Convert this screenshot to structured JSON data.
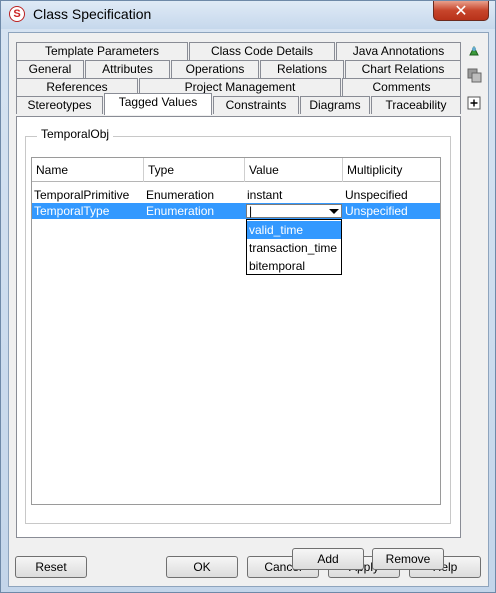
{
  "window": {
    "title": "Class Specification",
    "close_glyph": "✕",
    "app_icon": "S"
  },
  "tabs": {
    "row1": [
      "Template Parameters",
      "Class Code Details",
      "Java Annotations"
    ],
    "row2": [
      "General",
      "Attributes",
      "Operations",
      "Relations",
      "Chart Relations"
    ],
    "row3": [
      "References",
      "Project Management",
      "Comments"
    ],
    "row4": [
      "Stereotypes",
      "Tagged Values",
      "Constraints",
      "Diagrams",
      "Traceability"
    ],
    "active": "Tagged Values"
  },
  "panel": {
    "group_title": "TemporalObj",
    "columns": [
      "Name",
      "Type",
      "Value",
      "Multiplicity"
    ],
    "rows": [
      {
        "name": "TemporalPrimitive",
        "type": "Enumeration",
        "value": "instant",
        "multiplicity": "Unspecified"
      },
      {
        "name": "TemporalType",
        "type": "Enumeration",
        "value": "|",
        "multiplicity": "Unspecified"
      }
    ],
    "dropdown_options": [
      "valid_time",
      "transaction_time",
      "bitemporal"
    ],
    "dropdown_highlighted": "valid_time",
    "add_label": "Add",
    "remove_label": "Remove"
  },
  "footer": {
    "reset_label": "Reset",
    "ok_label": "OK",
    "cancel_label": "Cancel",
    "apply_label": "Apply",
    "help_label": "Help"
  },
  "colors": {
    "selection": "#3399ff",
    "annotation_arrow": "#dd2222"
  },
  "side_icons": [
    "pin-icon",
    "copy-icon",
    "expand-icon"
  ]
}
